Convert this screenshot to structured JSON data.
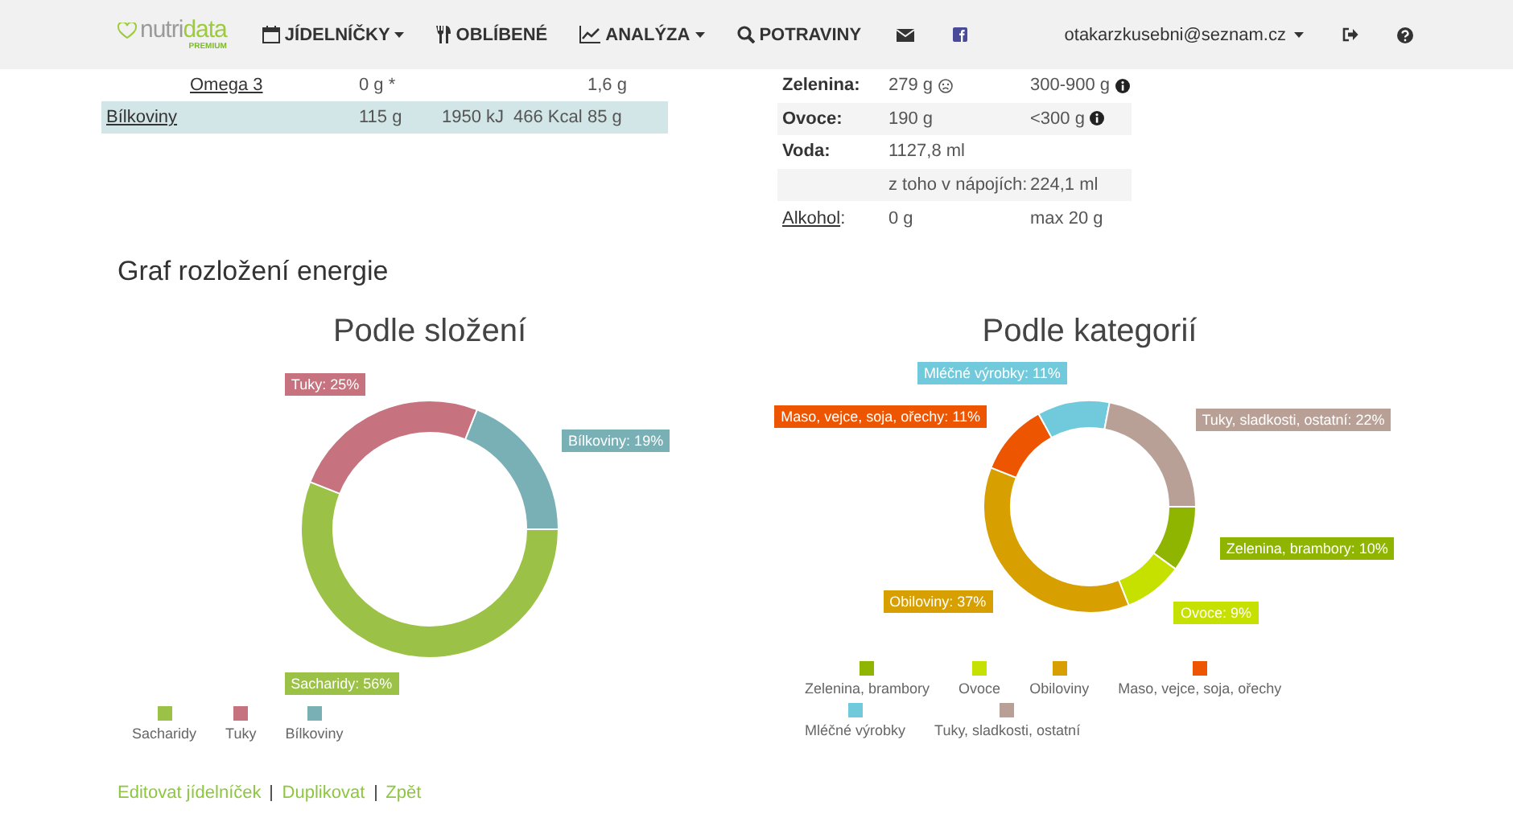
{
  "navbar": {
    "logo": {
      "main": "nutri",
      "accent": "data",
      "badge": "PREMIUM"
    },
    "menu": [
      {
        "label": "JÍDELNÍČKY",
        "kind": "dropdown"
      },
      {
        "label": "OBLÍBENÉ",
        "kind": "link"
      },
      {
        "label": "ANALÝZA",
        "kind": "dropdown"
      },
      {
        "label": "POTRAVINY",
        "kind": "link"
      }
    ],
    "user": {
      "email": "otakarzkusebni@seznam.cz"
    }
  },
  "nutrients": [
    {
      "kind": "sub",
      "name": "Omega 3",
      "amount": "0 g *",
      "target": "1,6 g"
    },
    {
      "kind": "total",
      "name": "Bílkoviny",
      "amount": "115 g",
      "energy_kj": "1950 kJ",
      "energy_kcal": "466 Kcal",
      "target": "85 g"
    }
  ],
  "summary": [
    {
      "kind": "label",
      "label": "Zelenina:",
      "value": "279 g",
      "below_range": true,
      "range": "300-900 g",
      "info": true
    },
    {
      "kind": "label",
      "label": "Ovoce:",
      "value": "190 g",
      "range": "<300 g",
      "info": true
    },
    {
      "kind": "label",
      "label": "Voda:",
      "value": "1127,8 ml"
    },
    {
      "kind": "sub",
      "value": "z toho v nápojích:",
      "range": "224,1 ml"
    },
    {
      "kind": "link",
      "label": "Alkohol",
      "suffix": ":",
      "value": "0 g",
      "range": "max 20 g"
    }
  ],
  "section_title": "Graf rozložení energie",
  "charts": [
    {
      "title": "Podle složení",
      "chart_data": {
        "type": "donut",
        "value_labels": [
          "Sacharidy: 56%",
          "Tuky: 25%",
          "Bílkoviny: 19%"
        ],
        "categories": [
          "Sacharidy",
          "Tuky",
          "Bílkoviny"
        ],
        "values": [
          56,
          25,
          19
        ],
        "colors": [
          "#9bc146",
          "#c6737f",
          "#79b0b5"
        ]
      }
    },
    {
      "title": "Podle kategorií",
      "chart_data": {
        "type": "donut",
        "value_labels": [
          "Zelenina, brambory: 10%",
          "Ovoce: 9%",
          "Obiloviny: 37%",
          "Maso, vejce, soja, ořechy: 11%",
          "Mléčné výrobky: 11%",
          "Tuky, sladkosti, ostatní: 22%"
        ],
        "categories": [
          "Zelenina, brambory",
          "Ovoce",
          "Obiloviny",
          "Maso, vejce, soja, ořechy",
          "Mléčné výrobky",
          "Tuky, sladkosti, ostatní"
        ],
        "values": [
          10,
          9,
          37,
          11,
          11,
          22
        ],
        "colors": [
          "#8fb500",
          "#c6e000",
          "#d89f00",
          "#ee5500",
          "#70cadb",
          "#b8a096"
        ]
      }
    }
  ],
  "footer_links": [
    "Editovat jídelníček",
    "Duplikovat",
    "Zpět"
  ]
}
